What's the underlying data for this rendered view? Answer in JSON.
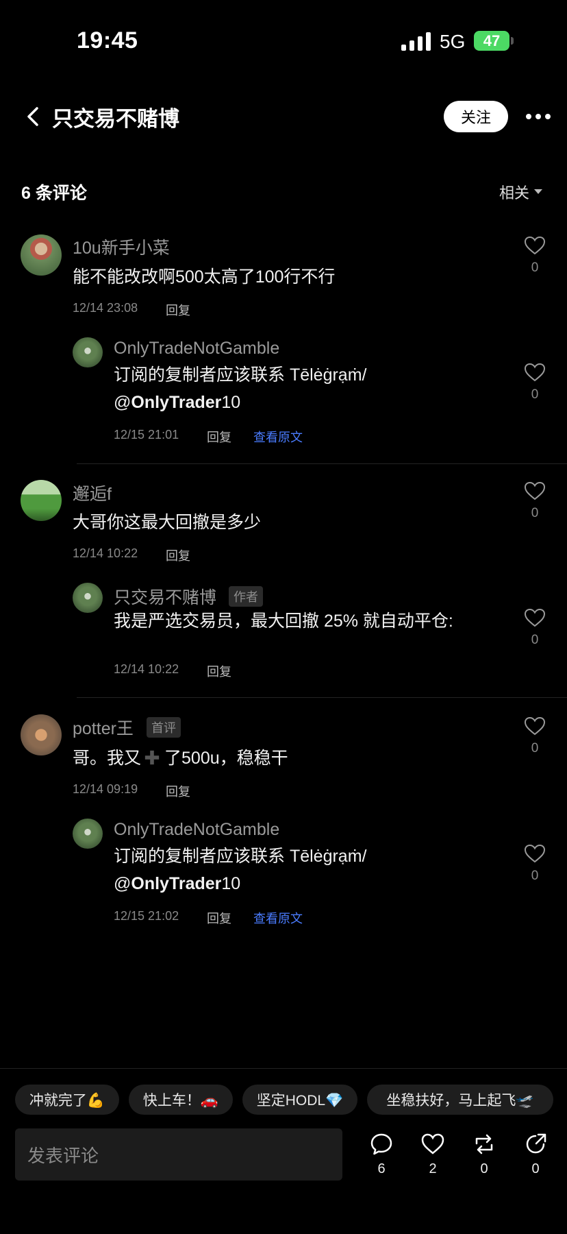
{
  "status_bar": {
    "time": "19:45",
    "network": "5G",
    "battery": "47"
  },
  "header": {
    "title": "只交易不赌博",
    "follow_label": "关注"
  },
  "comments_header": {
    "count_label": "6 条评论",
    "sort_label": "相关"
  },
  "comments": [
    {
      "name": "10u新手小菜",
      "text": "能不能改改啊500太高了100行不行",
      "time": "12/14 23:08",
      "reply_label": "回复",
      "likes": "0",
      "reply": {
        "name": "OnlyTradeNotGamble",
        "text_line1": "订阅的复制者应该联系 Tēlėġrạṁ/",
        "text_at": "@",
        "text_handle": "OnlyTrader",
        "text_num": "10",
        "time": "12/15 21:01",
        "reply_label": "回复",
        "orig_label": "查看原文",
        "likes": "0"
      }
    },
    {
      "name": "邂逅f",
      "text": "大哥你这最大回撤是多少",
      "time": "12/14 10:22",
      "reply_label": "回复",
      "likes": "0",
      "reply": {
        "name": "只交易不赌博",
        "tag": "作者",
        "text_line1": "我是严选交易员，最大回撤 25% 就自动平仓:",
        "time": "12/14 10:22",
        "reply_label": "回复",
        "likes": "0"
      }
    },
    {
      "name": "potter王",
      "tag": "首评",
      "text_a": "哥。我又",
      "text_b": "了500u，稳稳干",
      "time": "12/14 09:19",
      "reply_label": "回复",
      "likes": "0",
      "reply": {
        "name": "OnlyTradeNotGamble",
        "text_line1": "订阅的复制者应该联系 Tēlėġrạṁ/",
        "text_at": "@",
        "text_handle": "OnlyTrader",
        "text_num": "10",
        "time": "12/15 21:02",
        "reply_label": "回复",
        "orig_label": "查看原文",
        "likes": "0"
      }
    }
  ],
  "quick_replies": [
    "冲就完了💪",
    "快上车！🚗",
    "坚定HODL💎",
    "坐稳扶好，马上起飞🛫"
  ],
  "input_placeholder": "发表评论",
  "actions": {
    "comments": "6",
    "likes": "2",
    "reposts": "0",
    "shares": "0"
  },
  "colors": {
    "background": "#000000",
    "link": "#4a7cff",
    "battery": "#4cd964"
  }
}
